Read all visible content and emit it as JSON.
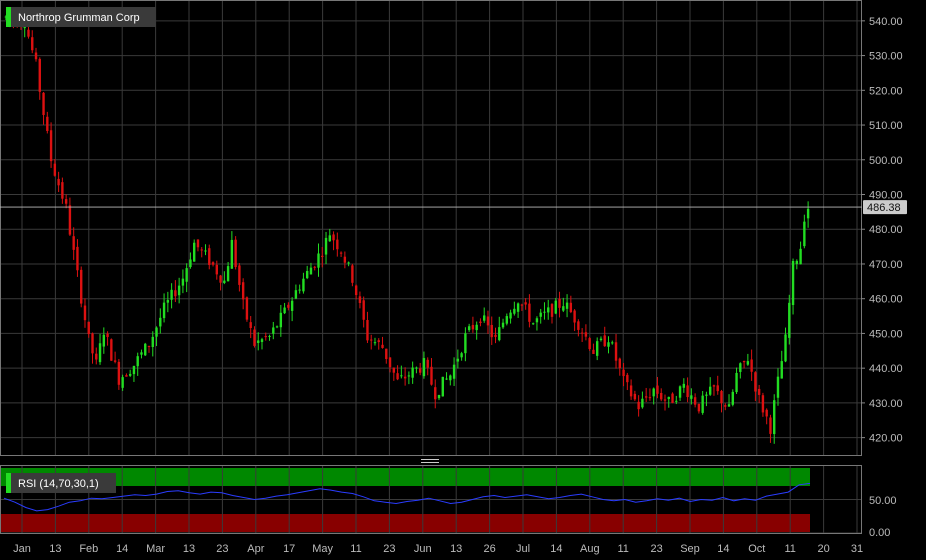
{
  "colors": {
    "background": "#000000",
    "grid": "#3a3a3a",
    "up": "#22dd22",
    "down": "#dd1111",
    "rsi_line": "#2a3cff",
    "rsi_overbought": "#008800",
    "rsi_oversold": "#880000",
    "label_bg": "#3a3a3a"
  },
  "chart_data": {
    "type": "candlestick",
    "title": "Northrop Grumman Corp",
    "last_price": "486.38",
    "price_axis": {
      "min": 415,
      "max": 546,
      "ticks": [
        "540.00",
        "530.00",
        "520.00",
        "510.00",
        "500.00",
        "490.00",
        "480.00",
        "470.00",
        "460.00",
        "450.00",
        "440.00",
        "430.00",
        "420.00"
      ]
    },
    "x_axis": {
      "labels": [
        "Jan",
        "13",
        "Feb",
        "14",
        "Mar",
        "13",
        "23",
        "Apr",
        "17",
        "May",
        "11",
        "23",
        "Jun",
        "13",
        "26",
        "Jul",
        "14",
        "Aug",
        "11",
        "23",
        "Sep",
        "14",
        "Oct",
        "11",
        "20",
        "31"
      ]
    },
    "trend": [
      [
        0,
        541
      ],
      [
        5,
        540
      ],
      [
        8,
        527
      ],
      [
        12,
        500
      ],
      [
        16,
        486
      ],
      [
        18,
        473
      ],
      [
        22,
        448
      ],
      [
        24,
        441
      ],
      [
        26,
        451
      ],
      [
        30,
        437
      ],
      [
        34,
        441
      ],
      [
        38,
        447
      ],
      [
        42,
        457
      ],
      [
        47,
        466
      ],
      [
        50,
        476
      ],
      [
        54,
        471
      ],
      [
        58,
        465
      ],
      [
        60,
        476
      ],
      [
        63,
        458
      ],
      [
        66,
        447
      ],
      [
        70,
        449
      ],
      [
        74,
        456
      ],
      [
        78,
        464
      ],
      [
        81,
        469
      ],
      [
        84,
        474
      ],
      [
        86,
        479
      ],
      [
        89,
        474
      ],
      [
        92,
        466
      ],
      [
        96,
        449
      ],
      [
        100,
        446
      ],
      [
        104,
        436
      ],
      [
        108,
        439
      ],
      [
        111,
        441
      ],
      [
        114,
        433
      ],
      [
        118,
        438
      ],
      [
        122,
        449
      ],
      [
        126,
        455
      ],
      [
        130,
        448
      ],
      [
        133,
        456
      ],
      [
        136,
        460
      ],
      [
        140,
        453
      ],
      [
        144,
        456
      ],
      [
        148,
        459
      ],
      [
        152,
        453
      ],
      [
        156,
        445
      ],
      [
        160,
        449
      ],
      [
        164,
        436
      ],
      [
        168,
        429
      ],
      [
        172,
        434
      ],
      [
        176,
        430
      ],
      [
        180,
        435
      ],
      [
        184,
        429
      ],
      [
        188,
        434
      ],
      [
        192,
        428
      ],
      [
        194,
        438
      ],
      [
        197,
        443
      ],
      [
        200,
        431
      ],
      [
        203,
        423
      ],
      [
        205,
        436
      ],
      [
        207,
        448
      ],
      [
        209,
        469
      ],
      [
        211,
        475
      ],
      [
        212,
        484
      ],
      [
        213,
        486.4
      ]
    ],
    "rsi": {
      "label": "RSI (14,70,30,1)",
      "axis_ticks": [
        "50.00",
        "0.00"
      ],
      "overbought": 70,
      "oversold": 30,
      "min": 0,
      "max": 100,
      "values": [
        52,
        46,
        38,
        33,
        35,
        40,
        46,
        48,
        52,
        51,
        53,
        55,
        57,
        56,
        58,
        62,
        63,
        60,
        58,
        61,
        60,
        56,
        53,
        50,
        52,
        55,
        57,
        60,
        63,
        66,
        64,
        61,
        59,
        54,
        48,
        46,
        44,
        47,
        49,
        52,
        48,
        44,
        46,
        50,
        54,
        56,
        53,
        55,
        57,
        54,
        51,
        53,
        56,
        58,
        54,
        50,
        48,
        50,
        46,
        48,
        51,
        49,
        52,
        47,
        50,
        49,
        53,
        48,
        51,
        49,
        55,
        58,
        61,
        72,
        74
      ]
    }
  }
}
